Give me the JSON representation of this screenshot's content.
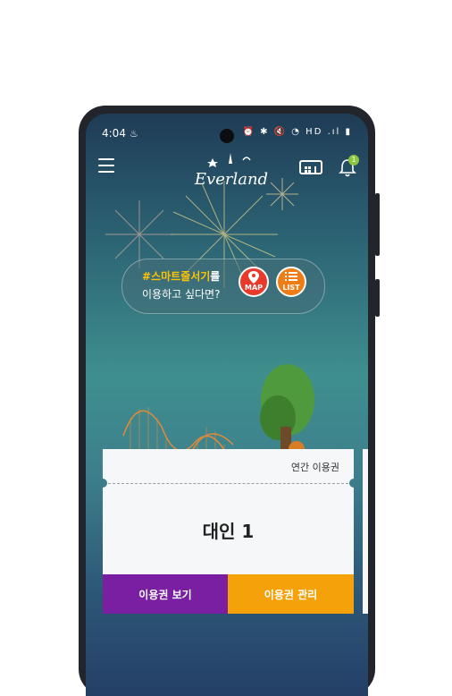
{
  "status_bar": {
    "time": "4:04",
    "notification_icon": "fire-icon",
    "right_icons": [
      "alarm-icon",
      "bluetooth-icon",
      "mute-icon",
      "wifi-icon",
      "hd-signal-icon",
      "battery-icon"
    ],
    "right_text": "⏰ ✱ 🔇 ◔ HD .ıl ▮"
  },
  "header": {
    "logo_text": "Everland",
    "menu_icon": "hamburger-menu-icon",
    "qr_icon": "qr-ticket-icon",
    "bell_icon": "bell-icon",
    "bell_badge": "1"
  },
  "bubble": {
    "highlight": "#스마트줄서기",
    "suffix": "를",
    "line2": "이용하고 싶다면?",
    "map_label": "MAP",
    "list_label": "LIST"
  },
  "ticket": {
    "type": "연간 이용권",
    "holder": "대인 1",
    "view_button": "이용권 보기",
    "manage_button": "이용권 관리"
  },
  "colors": {
    "view_button": "#7b1fa2",
    "manage_button": "#f5a10a",
    "highlight_text": "#ffc400",
    "map_button": "#e8392b",
    "list_button": "#f07c16",
    "badge": "#8cc63f"
  }
}
